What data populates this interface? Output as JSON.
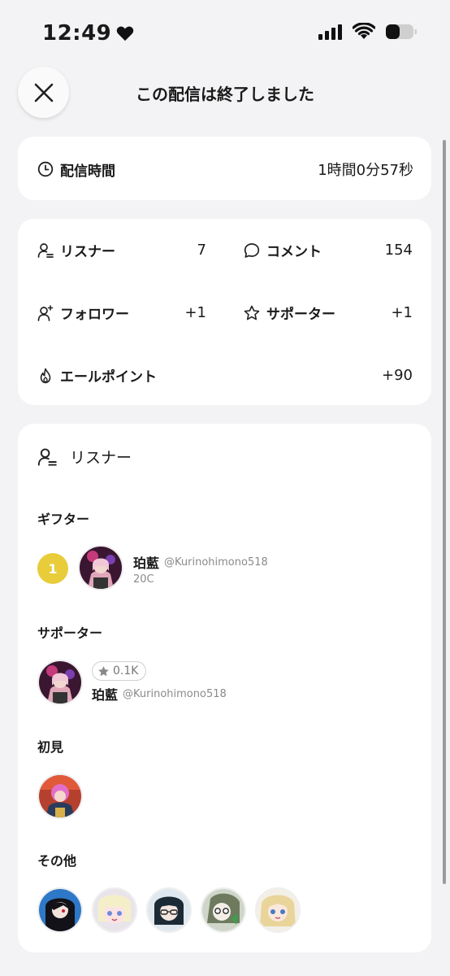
{
  "status_bar": {
    "time": "12:49"
  },
  "header": {
    "title": "この配信は終了しました"
  },
  "duration": {
    "label": "配信時間",
    "value": "1時間0分57秒"
  },
  "stats": {
    "listeners": {
      "label": "リスナー",
      "value": "7"
    },
    "comments": {
      "label": "コメント",
      "value": "154"
    },
    "followers": {
      "label": "フォロワー",
      "value": "+1"
    },
    "supporters": {
      "label": "サポーター",
      "value": "+1"
    },
    "yell_points": {
      "label": "エールポイント",
      "value": "+90"
    }
  },
  "listeners_section": {
    "title": "リスナー",
    "gifter": {
      "title": "ギフター",
      "rank": "1",
      "name": "珀藍",
      "handle": "@Kurinohimono518",
      "coins": "20C"
    },
    "supporter": {
      "title": "サポーター",
      "badge": "0.1K",
      "name": "珀藍",
      "handle": "@Kurinohimono518"
    },
    "first_time": {
      "title": "初見"
    },
    "others": {
      "title": "その他"
    }
  },
  "colors": {
    "accent_gold": "#e8cc3a",
    "background": "#f3f3f5",
    "card": "#ffffff"
  }
}
